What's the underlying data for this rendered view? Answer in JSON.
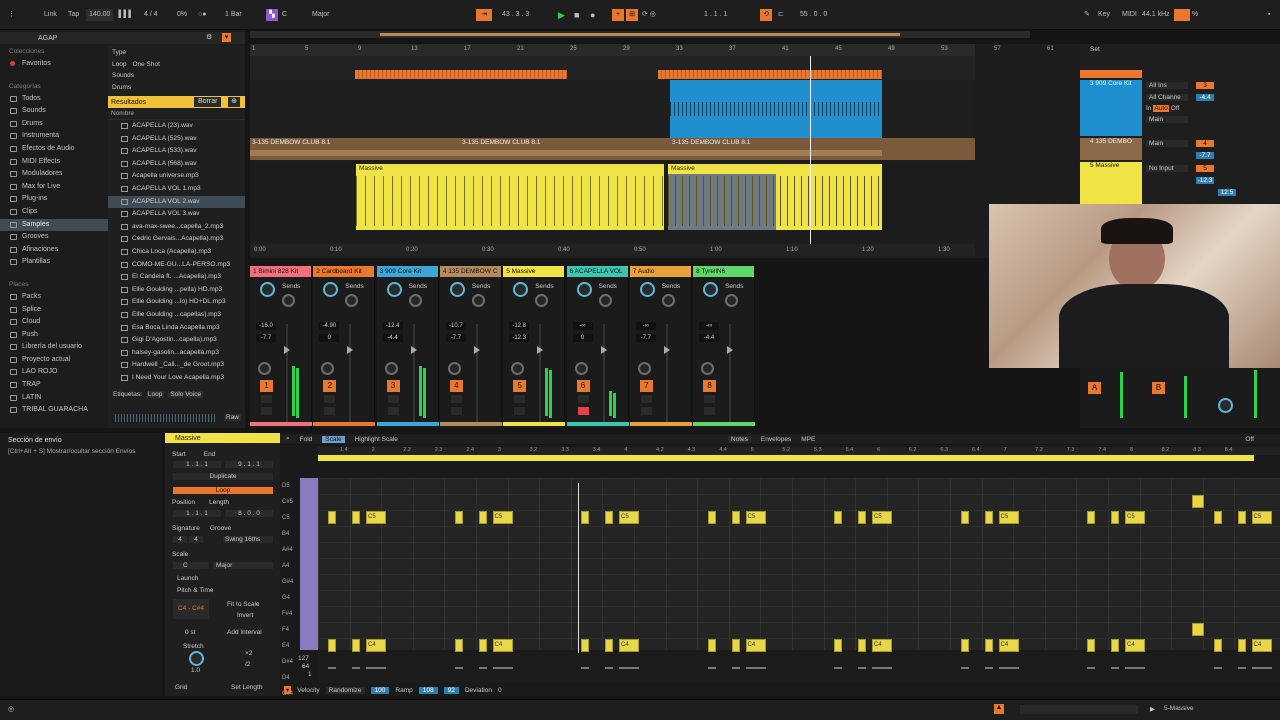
{
  "top": {
    "link": "Link",
    "tap": "Tap",
    "tempo": "140.00",
    "sig": "4 / 4",
    "cpu": "0%",
    "quant": "1 Bar",
    "key": "C",
    "scale": "Major",
    "pos": "43 . 3 . 3",
    "loop_start": "1 . 1 . 1",
    "loop_len": "55 . 0 . 0",
    "key_label": "Key",
    "midi": "MIDI",
    "rate": "44.1 kHz"
  },
  "browser": {
    "title": "AGAP",
    "collections_head": "Colecciones",
    "favorites": "Favoritos",
    "categories_head": "Categorías",
    "categories": [
      "Todos",
      "Sounds",
      "Drums",
      "Instrumenta",
      "Efectos de Audio",
      "MIDI Effects",
      "Moduladores",
      "Max for Live",
      "Plug-ins",
      "Clips",
      "Samples",
      "Grooves",
      "Afinaciones",
      "Plantillas"
    ],
    "places_head": "Places",
    "places": [
      "Packs",
      "Splice",
      "Cloud",
      "Push",
      "Librería del usuario",
      "Proyecto actual",
      "LAO ROJO",
      "TRAP",
      "LATIN",
      "TRIBAL GUARACHA"
    ],
    "filters": {
      "type": "Type",
      "loop": "Loop",
      "oneshot": "One Shot",
      "sounds": "Sounds",
      "drums": "Drums"
    },
    "results": "Resultados",
    "clear": "Borrar",
    "name_col": "Nombre",
    "files": [
      "ACAPELLA (23).wav",
      "ACAPELLA (525).wav",
      "ACAPELLA (533).wav",
      "ACAPELLA (568).wav",
      "Acapella universe.mp3",
      "ACAPELLA VOL 1.mp3",
      "ACAPELLA VOL 2.wav",
      "ACAPELLA VOL 3.wav",
      "ava-max-swee...capella_2.mp3",
      "Cedric Gervais...Acapella).mp3",
      "Chica Loca (Acapella).mp3",
      "COMO-ME-GU...LA-PERSO.mp3",
      "El Candela ft. ...Acapella).mp3",
      "Ellie Goulding ...pella) HD.mp3",
      "Ellie Goulding ...lo) HD+DL.mp3",
      "Ellie Goulding ...capellas).mp3",
      "Esa Boca Linda Acapella.mp3",
      "Gigi D'Agostin...capella).mp3",
      "halsey-gasolin...acapella.mp3",
      "Hardwell _Call..._de Groot.mp3",
      "I Need Your Love Acapella.mp3"
    ],
    "tags_label": "Etiquetas:",
    "tag_loop": "Loop",
    "tag_solo": "Solo Voice",
    "raw": "Raw"
  },
  "info": {
    "title": "Sección de envío",
    "text": "[Ctrl+Alt + S] Mostrar/ocultar sección Envíos"
  },
  "ruler": {
    "bars": [
      "1",
      "5",
      "9",
      "13",
      "17",
      "21",
      "25",
      "29",
      "33",
      "37",
      "41",
      "45",
      "49",
      "53",
      "57",
      "61"
    ],
    "times": [
      "0:00",
      "0:10",
      "0:20",
      "0:30",
      "0:40",
      "0:50",
      "1:00",
      "1:10",
      "1:20",
      "1:30"
    ]
  },
  "arr_clips": {
    "dembow": "3-135 DEMBOW CLUB 8.1",
    "massive": "Massive"
  },
  "tracks": [
    {
      "name": "1 Bimini 828 Kit",
      "color": "#f0707e",
      "vol": "-16.0",
      "pan": "-7.7",
      "num": "1"
    },
    {
      "name": "2 Cardboard Kit",
      "color": "#e9782e",
      "vol": "-4.90",
      "pan": "0",
      "num": "2"
    },
    {
      "name": "3 909 Core Kit",
      "color": "#3aa7d8",
      "vol": "-12.4",
      "pan": "-4.4",
      "num": "3"
    },
    {
      "name": "4 135 DEMBOW C",
      "color": "#b58a5c",
      "vol": "-10.7",
      "pan": "-7.7",
      "num": "4"
    },
    {
      "name": "5 Massive",
      "color": "#f0e345",
      "vol": "-12.8",
      "pan": "-12.3",
      "num": "5"
    },
    {
      "name": "6 ACAPELLA VOL",
      "color": "#3cc6b0",
      "vol": "-∞",
      "pan": "0",
      "num": "6"
    },
    {
      "name": "7 Audio",
      "color": "#e9a23a",
      "vol": "-∞",
      "pan": "-7.7",
      "num": "7"
    },
    {
      "name": "8 TyrellN6",
      "color": "#5fd86a",
      "vol": "-∞",
      "pan": "-4.4",
      "num": "8"
    }
  ],
  "sends_label": "Sends",
  "right_panel": {
    "set": "Set",
    "t1": "3 909 Core Kit",
    "t2": "4 135 DEMBO",
    "t3": "5 Massive",
    "allins": "All Ins",
    "allch": "All Channe",
    "in": "In",
    "auto": "Auto",
    "off": "Off",
    "main": "Main",
    "noinput": "No Input",
    "v1": "3",
    "v2": "-4.4",
    "v3": "4",
    "v4": "-7.7",
    "v5": "5",
    "v6": "-12.3",
    "v7": "12.5",
    "ret_a": "A",
    "ret_b": "B"
  },
  "clipview": {
    "name": "Massive",
    "fold": "Fold",
    "scale_btn": "Scale",
    "highlight": "Highlight Scale",
    "notes": "Notes",
    "envelopes": "Envelopes",
    "mpe": "MPE",
    "off": "Off",
    "start": "Start",
    "end": "End",
    "set": "Set",
    "start_v": "1 . 1 . 1",
    "end_v": "9 . 1 . 1",
    "duplicate": "Duplicate",
    "loop": "Loop",
    "position": "Position",
    "length": "Length",
    "pos_v": "1 . 1 . 1",
    "len_v": "8 . 0 . 0",
    "signature": "Signature",
    "groove": "Groove",
    "sig_v1": "4",
    "sig_v2": "4",
    "groove_v": "Swing 16ths",
    "scale": "Scale",
    "scale_key": "C",
    "scale_name": "Major",
    "launch": "Launch",
    "pitch": "Pitch & Time",
    "range": "C4 - C#4",
    "fit": "Fit to Scale",
    "invert": "Invert",
    "zero": "0 st",
    "add_interval": "Add Interval",
    "stretch": "Stretch",
    "x2": "×2",
    "d2": "/2",
    "grid": "Grid",
    "setlen": "Set Length",
    "stretch_v": "1.0"
  },
  "piano": {
    "keys": [
      "D5",
      "C#5",
      "C5",
      "B4",
      "A#4",
      "A4",
      "G#4",
      "G4",
      "F#4",
      "F4",
      "E4",
      "D#4",
      "D4",
      "C#4",
      "C4"
    ],
    "bar_labels": [
      "1.4",
      "2",
      "2.2",
      "2.3",
      "2.4",
      "3",
      "3.2",
      "3.3",
      "3.4",
      "4",
      "4.2",
      "4.3",
      "4.4",
      "5",
      "5.2",
      "5.3",
      "5.4",
      "6",
      "6.2",
      "6.3",
      "6.4",
      "7",
      "7.2",
      "7.3",
      "7.4",
      "8",
      "8.2",
      "8.3",
      "8.4"
    ],
    "c5": "C5",
    "c4": "C4",
    "v127": "127",
    "v64": "64",
    "v1": "1"
  },
  "velocity": {
    "label": "Velocity",
    "randomize": "Randomize",
    "rand_v": "100",
    "ramp": "Ramp",
    "ramp_a": "108",
    "ramp_b": "92",
    "deviation": "Deviation",
    "dev_v": "0"
  },
  "status": {
    "track": "5-Massive"
  }
}
